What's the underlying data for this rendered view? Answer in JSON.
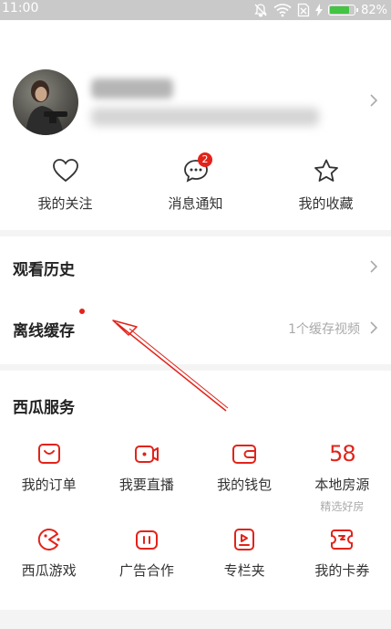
{
  "status_bar": {
    "time": "11:00",
    "battery_text": "82%",
    "battery_level": 0.82,
    "icons": [
      "mute-icon",
      "wifi-icon",
      "sim-off-icon",
      "charging-icon",
      "battery-icon"
    ]
  },
  "profile": {
    "avatar_icon": "avatar",
    "chevron_icon": "chevron-right-icon"
  },
  "quick_actions": [
    {
      "label": "我的关注",
      "icon": "heart-icon"
    },
    {
      "label": "消息通知",
      "icon": "message-icon",
      "badge": "2"
    },
    {
      "label": "我的收藏",
      "icon": "star-icon"
    }
  ],
  "menu": {
    "history": {
      "title": "观看历史"
    },
    "offline": {
      "title": "离线缓存",
      "info": "1个缓存视频"
    }
  },
  "services": {
    "title": "西瓜服务",
    "row1": [
      {
        "label": "我的订单",
        "icon": "order-icon"
      },
      {
        "label": "我要直播",
        "icon": "live-camera-icon"
      },
      {
        "label": "我的钱包",
        "icon": "wallet-icon"
      },
      {
        "label": "本地房源",
        "icon": "58",
        "sub": "精选好房"
      }
    ],
    "row2": [
      {
        "label": "西瓜游戏",
        "icon": "game-icon"
      },
      {
        "label": "广告合作",
        "icon": "ad-icon"
      },
      {
        "label": "专栏夹",
        "icon": "column-icon"
      },
      {
        "label": "我的卡券",
        "icon": "coupon-icon"
      }
    ]
  },
  "colors": {
    "accent": "#e2231a",
    "divider": "#f4f4f4",
    "status_bar": "#c9c9c9"
  }
}
